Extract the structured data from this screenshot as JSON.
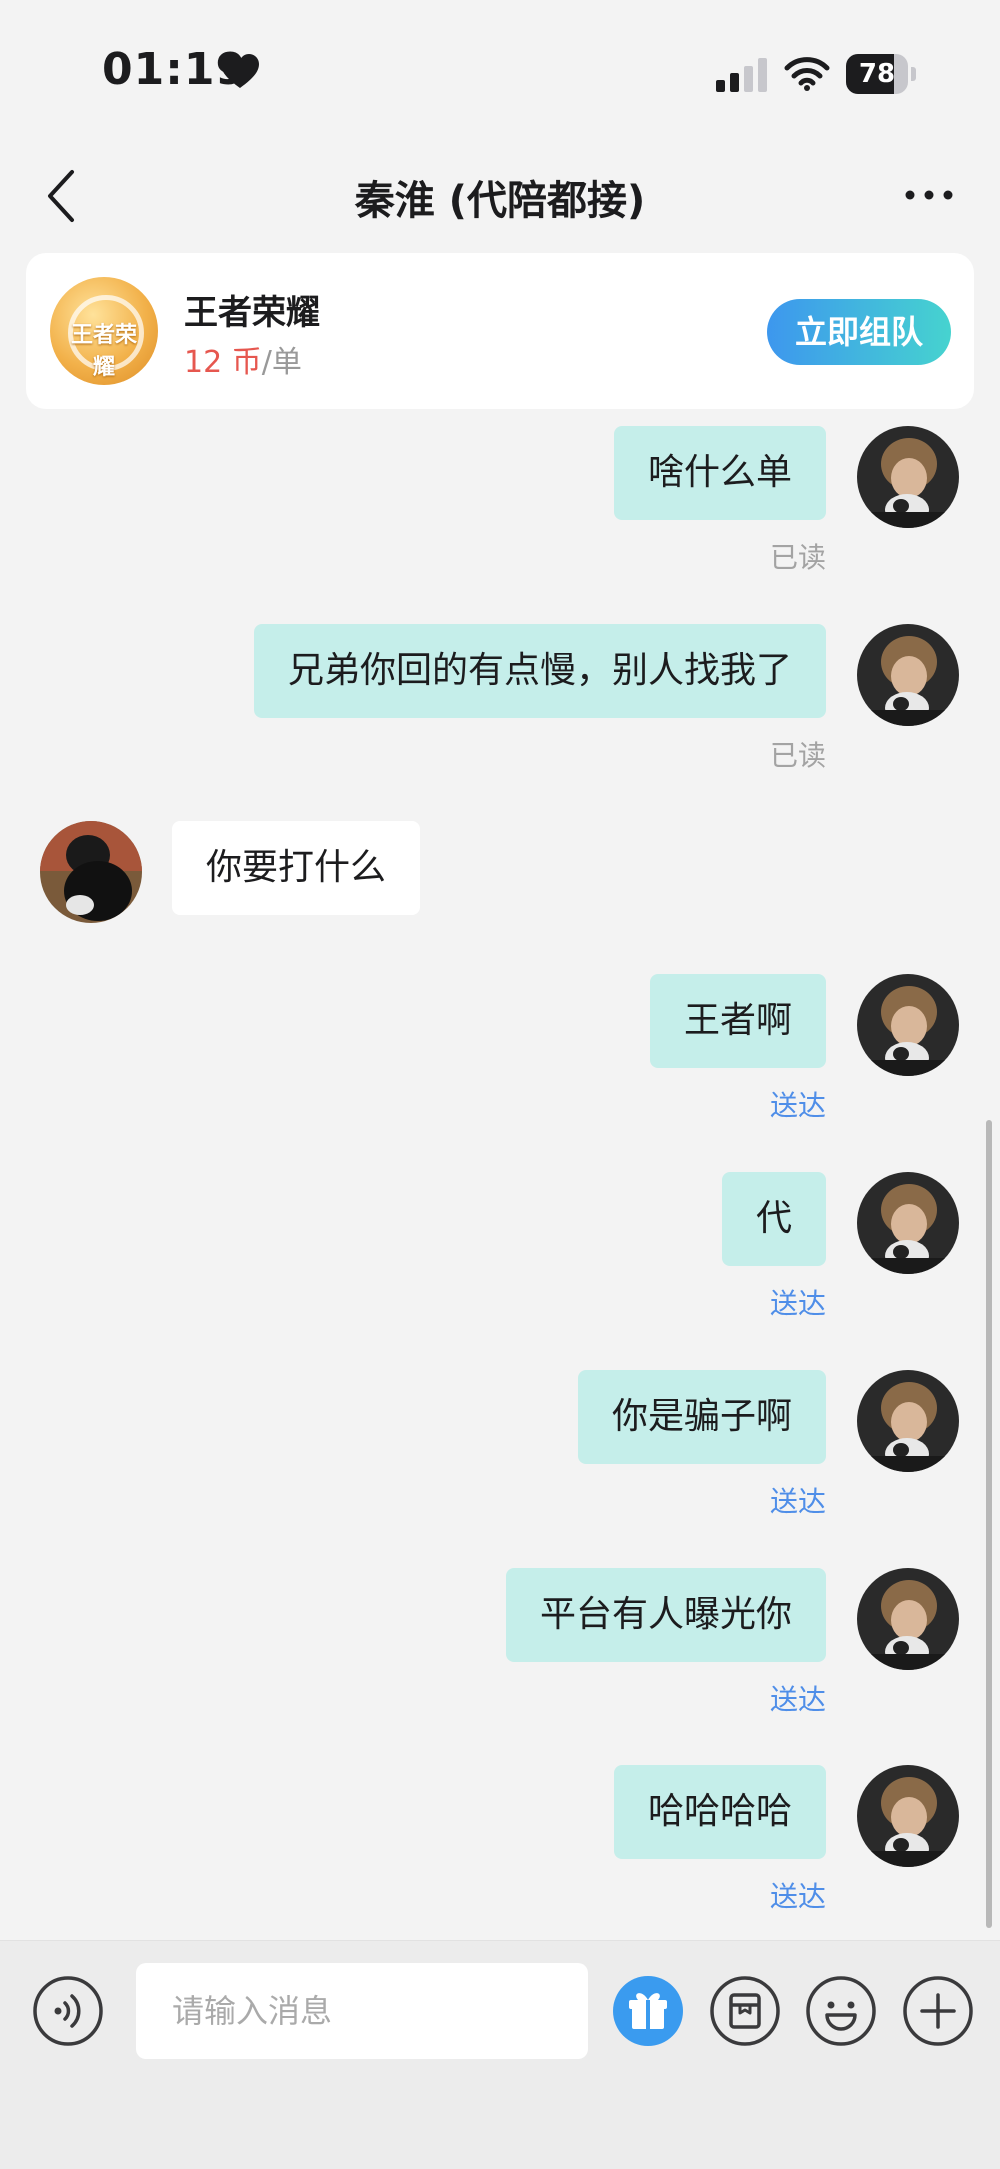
{
  "status_bar": {
    "time": "01:19",
    "battery_level": "78"
  },
  "nav": {
    "title": "秦淮 (代陪都接)"
  },
  "game_card": {
    "name": "王者荣耀",
    "price": "12 币",
    "price_sep": "/",
    "unit": "单",
    "logo_text": "王者荣耀",
    "button_label": "立即组队"
  },
  "messages": [
    {
      "side": "out",
      "text": "啥什么单",
      "status": "已读"
    },
    {
      "side": "out",
      "text": "兄弟你回的有点慢，别人找我了",
      "status": "已读"
    },
    {
      "side": "in",
      "text": "你要打什么"
    },
    {
      "side": "out",
      "text": "王者啊",
      "status": "送达"
    },
    {
      "side": "out",
      "text": "代",
      "status": "送达"
    },
    {
      "side": "out",
      "text": "你是骗子啊",
      "status": "送达"
    },
    {
      "side": "out",
      "text": "平台有人曝光你",
      "status": "送达"
    },
    {
      "side": "out",
      "text": "哈哈哈哈",
      "status": "送达"
    }
  ],
  "input_bar": {
    "placeholder": "请输入消息",
    "icons": [
      "voice-icon",
      "gift-icon",
      "box-icon",
      "emoji-icon",
      "plus-icon"
    ]
  },
  "colors": {
    "outgoing_bubble": "#c5eeea",
    "read_status": "#a3a3a3",
    "delivered_status": "#4f8ee8",
    "price_red": "#e6574f",
    "button_gradient_start": "#3d97ee",
    "button_gradient_end": "#46d3cf"
  }
}
